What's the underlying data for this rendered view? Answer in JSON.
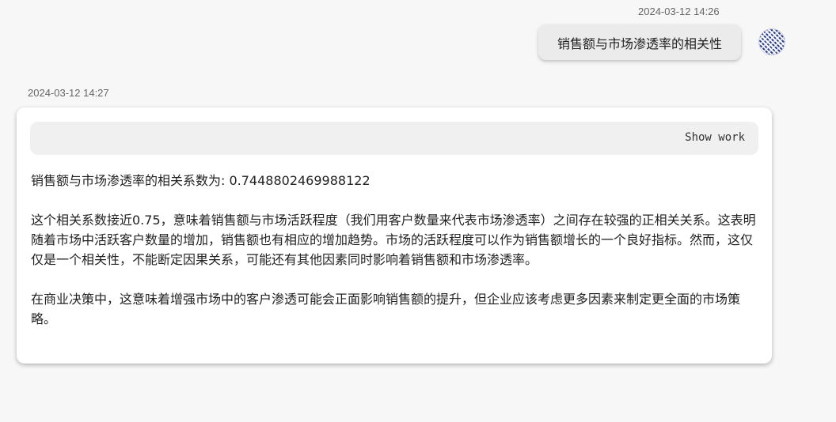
{
  "user_message": {
    "timestamp": "2024-03-12 14:26",
    "text": "销售额与市场渗透率的相关性"
  },
  "bot_message": {
    "timestamp": "2024-03-12 14:27",
    "show_work_label": "Show work",
    "paragraphs": [
      "销售额与市场渗透率的相关系数为: 0.7448802469988122",
      "这个相关系数接近0.75，意味着销售额与市场活跃程度（我们用客户数量来代表市场渗透率）之间存在较强的正相关关系。这表明随着市场中活跃客户数量的增加，销售额也有相应的增加趋势。市场的活跃程度可以作为销售额增长的一个良好指标。然而，这仅仅是一个相关性，不能断定因果关系，可能还有其他因素同时影响着销售额和市场渗透率。",
      "在商业决策中，这意味着增强市场中的客户渗透可能会正面影响销售额的提升，但企业应该考虑更多因素来制定更全面的市场策略。"
    ]
  },
  "icons": {
    "avatar": "user-avatar-icon"
  },
  "colors": {
    "background": "#f7f7f8",
    "user_bubble": "#ebebec",
    "card": "#ffffff",
    "show_work_bar": "#f0f0f1",
    "timestamp": "#666666"
  }
}
